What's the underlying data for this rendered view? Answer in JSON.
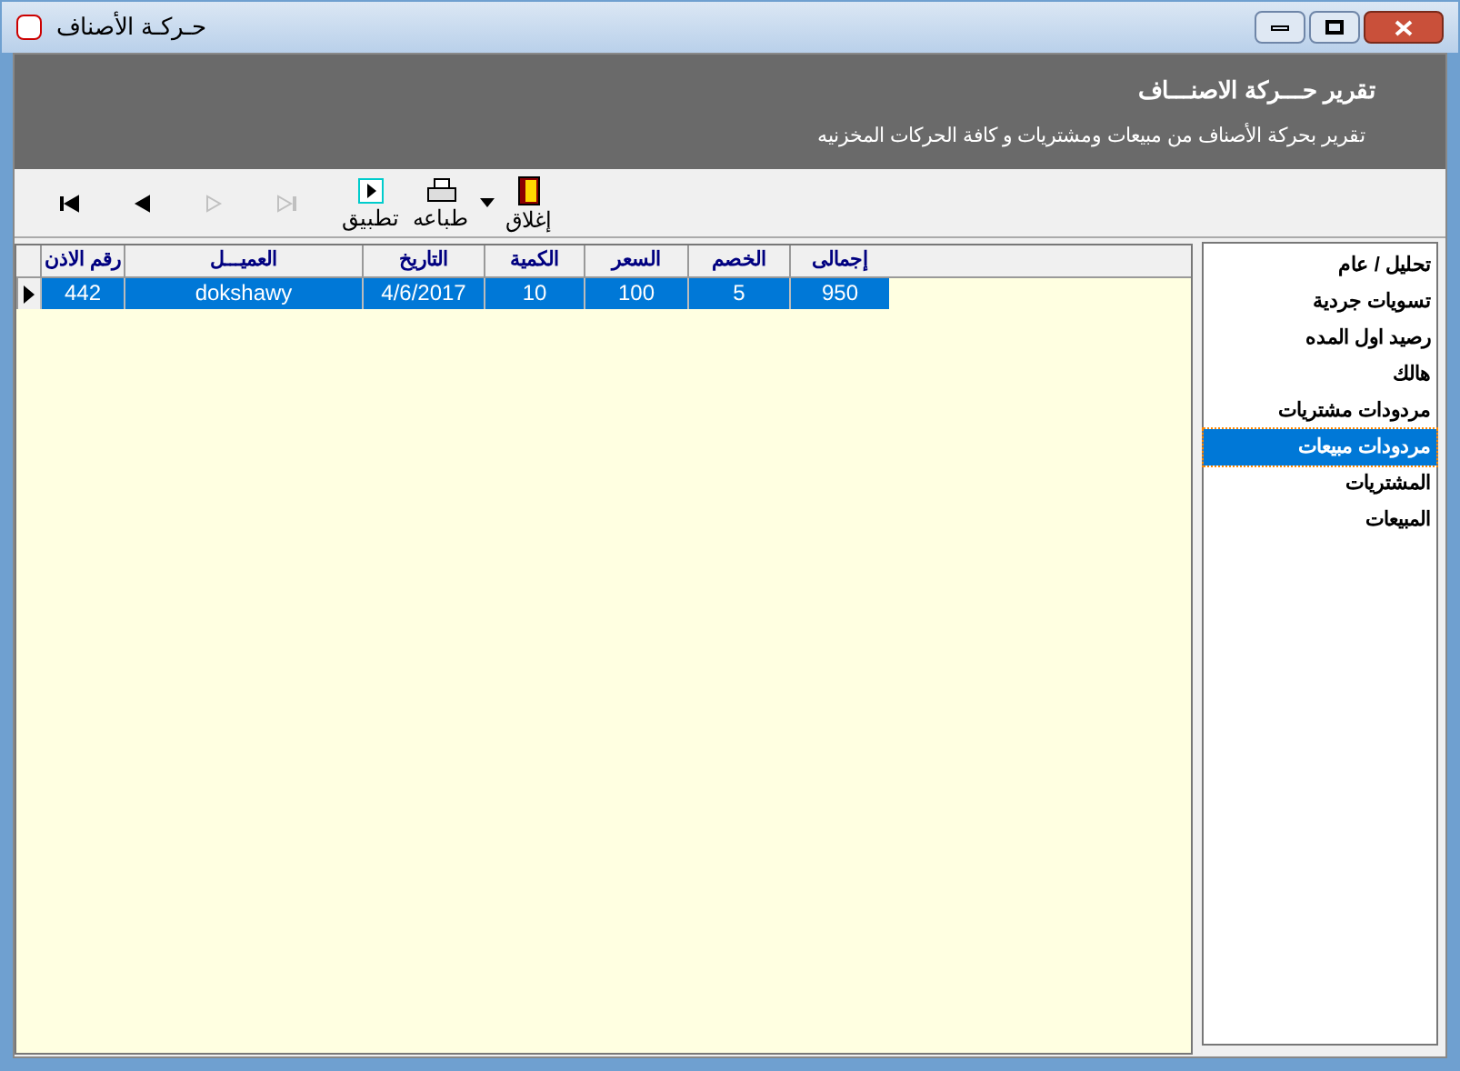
{
  "window": {
    "title": "حـركـة الأصناف"
  },
  "header": {
    "title": "تقرير حـــركة الاصنـــاف",
    "subtitle": "تقرير بحركة الأصناف من مبيعات ومشتريات و كافة الحركات المخزنيه"
  },
  "toolbar": [
    {
      "kind": "close",
      "label": "إغلاق"
    },
    {
      "kind": "dropdown"
    },
    {
      "kind": "print",
      "label": "طباعه"
    },
    {
      "kind": "apply",
      "label": "تطبيق"
    },
    {
      "kind": "last",
      "disabled": true
    },
    {
      "kind": "next",
      "disabled": true
    },
    {
      "kind": "prev",
      "disabled": false
    },
    {
      "kind": "first",
      "disabled": false
    }
  ],
  "table": {
    "columns": [
      "إجمالى",
      "الخصم",
      "السعر",
      "الكمية",
      "التاريخ",
      "العميـــل",
      "رقم الاذن"
    ],
    "rows": [
      {
        "selected": true,
        "cells": [
          "950",
          "5",
          "100",
          "10",
          "4/6/2017",
          "dokshawy",
          "442"
        ]
      }
    ]
  },
  "sidebar": {
    "items": [
      {
        "label": "تحليل / عام",
        "selected": false
      },
      {
        "label": "تسويات جردية",
        "selected": false
      },
      {
        "label": "رصيد اول المده",
        "selected": false
      },
      {
        "label": "هالك",
        "selected": false
      },
      {
        "label": "مردودات مشتريات",
        "selected": false
      },
      {
        "label": "مردودات مبيعات",
        "selected": true
      },
      {
        "label": "المشتريات",
        "selected": false
      },
      {
        "label": "المبيعات",
        "selected": false
      }
    ]
  }
}
